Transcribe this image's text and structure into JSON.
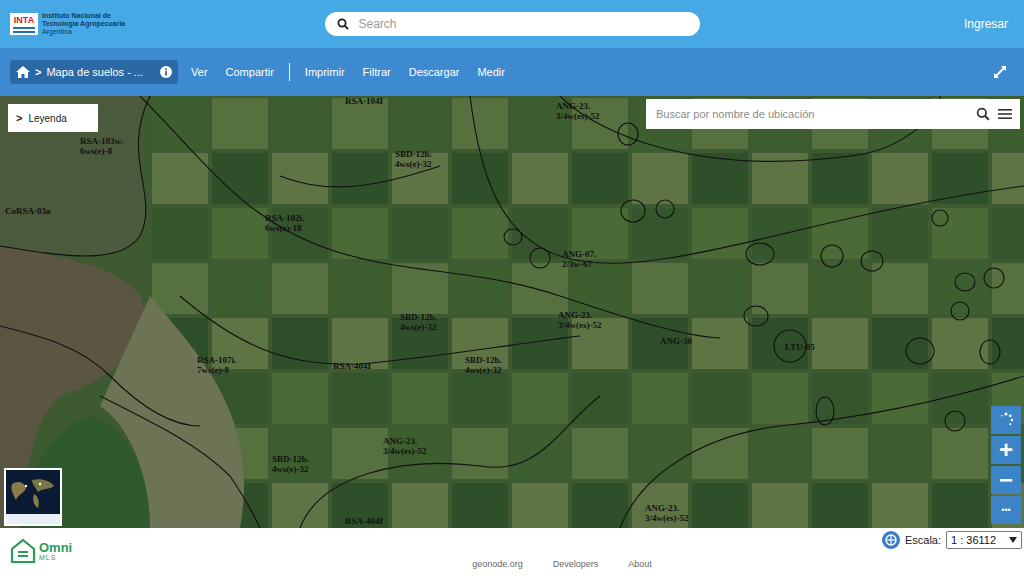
{
  "header": {
    "logo_mark": "INTA",
    "logo_lines": [
      "Instituto Nacional de",
      "Tecnología Agropecuaria",
      "Argentina"
    ],
    "search_placeholder": "Search",
    "login": "Ingresar"
  },
  "toolbar": {
    "breadcrumb_separator": ">",
    "breadcrumb": "Mapa de suelos - ...",
    "menu": [
      {
        "kind": "item",
        "label": "Ver"
      },
      {
        "kind": "item",
        "label": "Compartir"
      },
      {
        "kind": "separator",
        "label": ""
      },
      {
        "kind": "item",
        "label": "Imprimir"
      },
      {
        "kind": "item",
        "label": "Filtrar"
      },
      {
        "kind": "item",
        "label": "Descargar"
      },
      {
        "kind": "item",
        "label": "Medir"
      }
    ]
  },
  "map": {
    "legend": {
      "arrow": ">",
      "label": "Leyenda"
    },
    "location_search": {
      "placeholder": "Buscar por nombre de ubicación"
    },
    "labels": [
      {
        "lines": [
          "RSA-104I"
        ]
      },
      {
        "lines": [
          "RSA-103w.",
          "6ws(e)-8"
        ]
      },
      {
        "lines": [
          "CoRSA-03a"
        ]
      },
      {
        "lines": [
          "ANG-23.",
          "3/4w(es)-52"
        ]
      },
      {
        "lines": [
          "SBD-12b.",
          "4ws(e)-32"
        ]
      },
      {
        "lines": [
          "RSA-102i.",
          "6ws(e)-18"
        ]
      },
      {
        "lines": [
          "ANG-07.",
          "2/3w-67"
        ]
      },
      {
        "lines": [
          "SBD-12b.",
          "4ws(e)-32"
        ]
      },
      {
        "lines": [
          "ANG-23.",
          "3/4w(es)-52"
        ]
      },
      {
        "lines": [
          "ANG-30"
        ]
      },
      {
        "lines": [
          "LTU-05"
        ]
      },
      {
        "lines": [
          "RSA-107i.",
          "7ws(e)-8"
        ]
      },
      {
        "lines": [
          "RSA-404I"
        ]
      },
      {
        "lines": [
          "SBD-12b.",
          "4ws(e)-32"
        ]
      },
      {
        "lines": [
          "ANG-23.",
          "3/4w(es)-52"
        ]
      },
      {
        "lines": [
          "SBD-12b.",
          "4ws(e)-32"
        ]
      },
      {
        "lines": [
          "RSA-404I"
        ]
      },
      {
        "lines": [
          "ANG-23.",
          "3/4w(es)-52"
        ]
      }
    ],
    "zoom_in": "+",
    "zoom_out": "−",
    "more": "•••"
  },
  "footer": {
    "brand": "Omni",
    "brand_sub": "MLS",
    "links": [
      "geonode.org",
      "Developers",
      "About"
    ],
    "scale_label": "Escala:",
    "scale_value": "1 : 36112"
  }
}
